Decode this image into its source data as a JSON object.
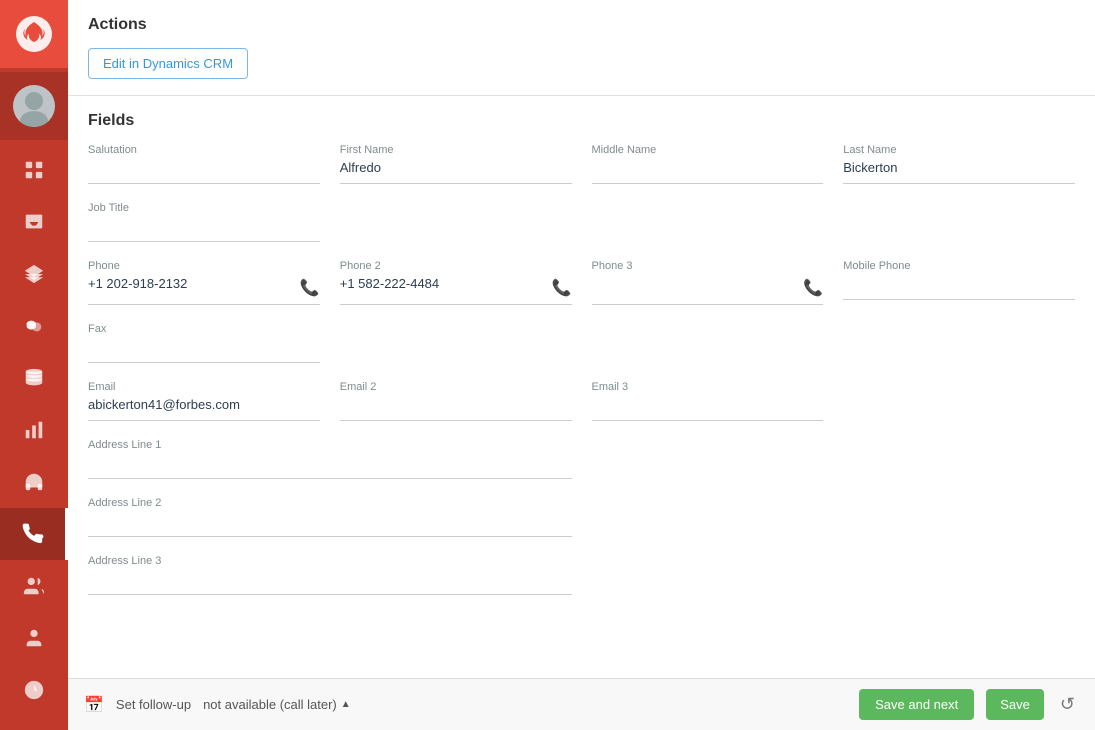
{
  "sidebar": {
    "logo_alt": "App Logo",
    "items": [
      {
        "id": "dashboard",
        "icon": "grid",
        "active": false
      },
      {
        "id": "inbox",
        "icon": "inbox",
        "active": false
      },
      {
        "id": "layers",
        "icon": "layers",
        "active": false
      },
      {
        "id": "coins",
        "icon": "coins",
        "active": false
      },
      {
        "id": "database",
        "icon": "database",
        "active": false
      },
      {
        "id": "bar-chart",
        "icon": "bar-chart",
        "active": false
      },
      {
        "id": "headphones",
        "icon": "headphones",
        "active": false
      },
      {
        "id": "phone",
        "icon": "phone",
        "active": true
      },
      {
        "id": "users-cog",
        "icon": "users-cog",
        "active": false
      },
      {
        "id": "user",
        "icon": "user",
        "active": false
      },
      {
        "id": "clock",
        "icon": "clock",
        "active": false
      }
    ]
  },
  "actions": {
    "title": "Actions",
    "edit_crm_label": "Edit in Dynamics CRM"
  },
  "fields": {
    "title": "Fields",
    "salutation": {
      "label": "Salutation",
      "value": ""
    },
    "first_name": {
      "label": "First Name",
      "value": "Alfredo"
    },
    "middle_name": {
      "label": "Middle Name",
      "value": ""
    },
    "last_name": {
      "label": "Last Name",
      "value": "Bickerton"
    },
    "job_title": {
      "label": "Job Title",
      "value": ""
    },
    "phone": {
      "label": "Phone",
      "value": "+1 202-918-2132"
    },
    "phone2": {
      "label": "Phone 2",
      "value": "+1 582-222-4484"
    },
    "phone3": {
      "label": "Phone 3",
      "value": ""
    },
    "mobile_phone": {
      "label": "Mobile Phone",
      "value": ""
    },
    "fax": {
      "label": "Fax",
      "value": ""
    },
    "email": {
      "label": "Email",
      "value": "abickerton41@forbes.com"
    },
    "email2": {
      "label": "Email 2",
      "value": ""
    },
    "email3": {
      "label": "Email 3",
      "value": ""
    },
    "address_line1": {
      "label": "Address Line 1",
      "value": ""
    },
    "address_line2": {
      "label": "Address Line 2",
      "value": ""
    },
    "address_line3": {
      "label": "Address Line 3",
      "value": ""
    }
  },
  "bottom_bar": {
    "follow_up_label": "Set follow-up",
    "follow_up_status": "not available (call later)",
    "save_next_label": "Save and next",
    "save_label": "Save",
    "reset_icon": "↺"
  }
}
